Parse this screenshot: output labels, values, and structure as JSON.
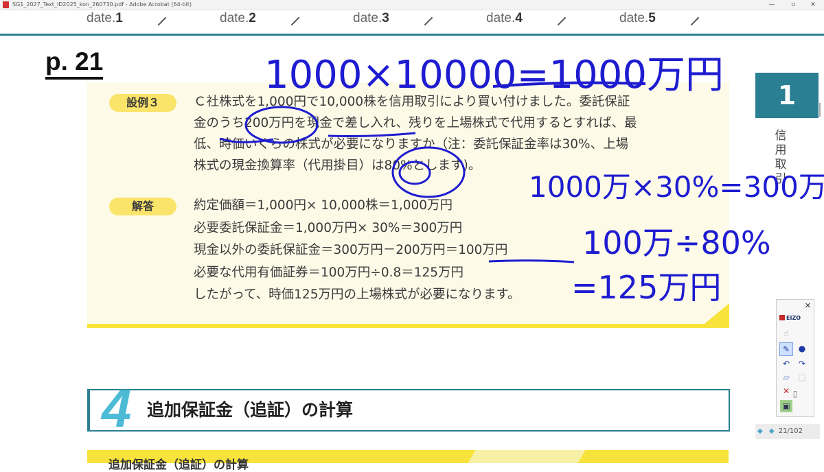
{
  "window": {
    "title": "SG1_2027_Text_ID2025_kon_260730.pdf - Adobe Acrobat (64-bit)",
    "minimize": "—",
    "maximize": "▫",
    "close": "✕"
  },
  "dates": [
    {
      "label": "date.",
      "num": "1"
    },
    {
      "label": "date.",
      "num": "2"
    },
    {
      "label": "date.",
      "num": "3"
    },
    {
      "label": "date.",
      "num": "4"
    },
    {
      "label": "date.",
      "num": "5"
    }
  ],
  "page_label": "p. 21",
  "example": {
    "tag": "設例３",
    "question": [
      "Ｃ社株式を1,000円で10,000株を信用取引により買い付けました。委託保証",
      "金のうち200万円を現金で差し入れ、残りを上場株式で代用するとすれば、最",
      "低、時価いくらの株式が必要になりますか（注：委託保証金率は30%、上場",
      "株式の現金換算率（代用掛目）は80%とします)。"
    ],
    "answer_tag": "解答",
    "answer": [
      "約定価額＝1,000円× 10,000株＝1,000万円",
      "必要委託保証金＝1,000万円× 30%＝300万円",
      "現金以外の委託保証金＝300万円－200万円＝100万円",
      "必要な代用有価証券＝100万円÷0.8＝125万円",
      "したがって、時価125万円の上場株式が必要になります。"
    ]
  },
  "side": {
    "chapter_num": "1",
    "chapter_label": "信用取引"
  },
  "section": {
    "num": "4",
    "title": "追加保証金（追証）の計算",
    "next_heading": "追加保証金（追証）の計算"
  },
  "annotations": {
    "top": "1000×10000=1000万円",
    "right1": "1000万×30%=300万",
    "right2": "100万÷80%",
    "right3": "=125万円"
  },
  "palette": {
    "brand": "EIZO",
    "close": "✕"
  },
  "pager": {
    "page": "21/102"
  },
  "colors": {
    "teal": "#2a7f92",
    "yellow": "#f7e33b",
    "ink_blue": "#1e1cd0"
  }
}
